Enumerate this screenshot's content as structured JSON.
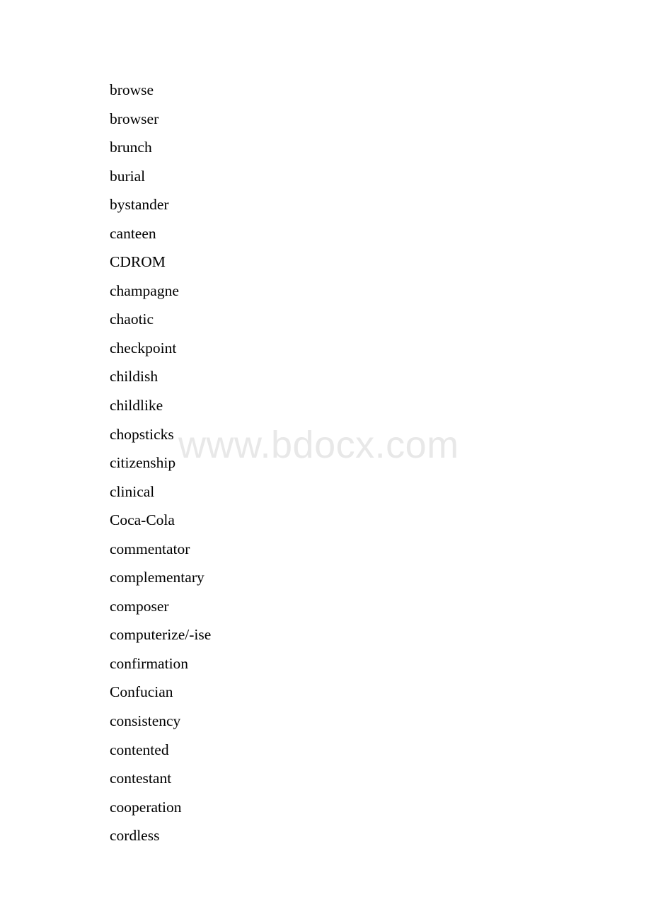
{
  "document": {
    "type": "word-list-page",
    "background_color": "#ffffff",
    "text_color": "#000000",
    "watermark": {
      "text": "www.bdocx.com",
      "color": "#e8e8e8"
    },
    "words": [
      "browse",
      "browser",
      "brunch",
      "burial",
      "bystander",
      "canteen",
      "CDROM",
      "champagne",
      "chaotic",
      "checkpoint",
      "childish",
      "childlike",
      "chopsticks",
      "citizenship",
      "clinical",
      "Coca-Cola",
      "commentator",
      "complementary",
      "composer",
      "computerize/-ise",
      "confirmation",
      "Confucian",
      "consistency",
      "contented",
      "contestant",
      "cooperation",
      "cordless"
    ]
  }
}
